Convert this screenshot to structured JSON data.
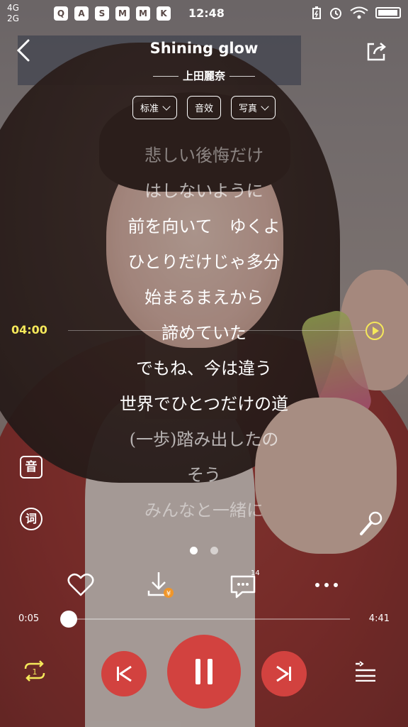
{
  "status_bar": {
    "net1": "4G",
    "net2": "2G",
    "time": "12:48",
    "app_icons": [
      "Q",
      "A",
      "S",
      "M",
      "M",
      "K"
    ]
  },
  "header": {
    "title": "Shining glow",
    "artist": "上田麗奈"
  },
  "pills": [
    {
      "label": "标准",
      "has_chevron": true
    },
    {
      "label": "音效",
      "has_chevron": false
    },
    {
      "label": "写真",
      "has_chevron": true
    }
  ],
  "lyrics": [
    "悲しい後悔だけ",
    "はしないように",
    "前を向いて　ゆくよ",
    "ひとりだけじゃ多分",
    "始まるまえから",
    "諦めていた",
    "でもね、今は違う",
    "世界でひとつだけの道",
    "(一歩)踏み出したの",
    "そう",
    "みんなと一緒に"
  ],
  "lyric_marker": {
    "time": "04:00"
  },
  "side": {
    "sound_label": "音",
    "lyric_label": "词"
  },
  "actions": {
    "comment_count": "14"
  },
  "progress": {
    "current": "0:05",
    "total": "4:41",
    "fraction": 0.018
  },
  "colors": {
    "accent": "#d2423f",
    "highlight": "#f5e85a"
  }
}
